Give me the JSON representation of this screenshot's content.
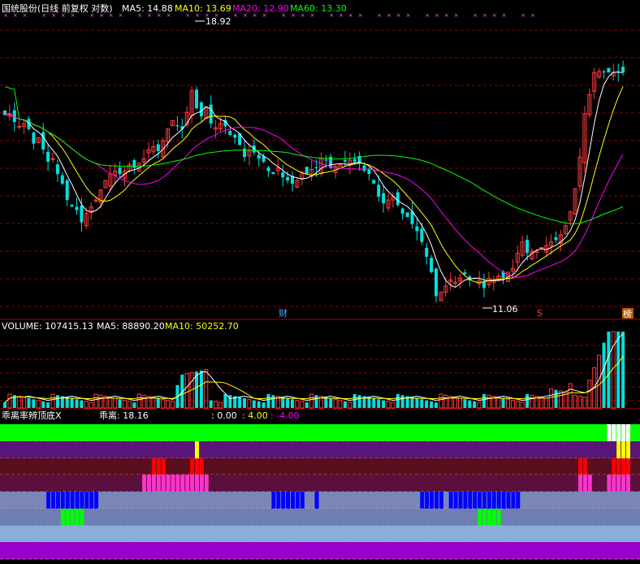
{
  "header": {
    "title": "国统股份(日线 前复权 对数)",
    "ma5": "MA5: 14.88",
    "ma10": "MA10: 13.69",
    "ma20": "MA20: 12.90",
    "ma60": "MA60: 13.30"
  },
  "annotations": {
    "high_label": "18.92",
    "low_label": "11.06",
    "marker_cai": "财",
    "marker_s": "S",
    "marker_bang": "榜"
  },
  "volume_header": {
    "volume": "VOLUME: 107415.13",
    "ma5": "MA5: 88890.20",
    "ma10": "MA10: 50252.70"
  },
  "indicator_header": {
    "name": "乖离率辨顶底X",
    "value_label": "乖离: 18.16",
    "v1": ": 0.00",
    "v2": ": 4.00",
    "v3": ": -4.00"
  },
  "colors": {
    "up": "#ff3b3b",
    "down": "#00e0e0",
    "ma5": "#ffffff",
    "ma10": "#ffff00",
    "ma20": "#ff00ff",
    "ma60": "#00ff00",
    "grid": "#8b0000"
  },
  "chart_data": {
    "type": "candlestick",
    "scale": "log",
    "y_range": [
      10.6,
      20.6
    ],
    "series_points": 130,
    "price_high": 18.92,
    "price_low": 11.06,
    "close_last": 18.16,
    "volume_last": 107415.13,
    "volume_ma5_last": 88890.2,
    "volume_ma10_last": 50252.7,
    "indicator_values": {
      "deviation": 18.16,
      "zero": 0.0,
      "upper": 4.0,
      "lower": -4.0
    },
    "closes": [
      16.55,
      16.6,
      16.3,
      16.15,
      16.25,
      16.05,
      15.55,
      15.75,
      15.35,
      14.95,
      15.05,
      14.55,
      14.25,
      13.75,
      13.55,
      13.45,
      13.1,
      13.35,
      13.55,
      13.75,
      14.05,
      14.35,
      14.55,
      14.65,
      14.55,
      14.65,
      14.85,
      14.75,
      14.9,
      15.05,
      15.35,
      15.45,
      15.3,
      15.65,
      16.05,
      16.35,
      16.15,
      16.05,
      16.65,
      17.45,
      16.8,
      16.5,
      16.85,
      16.25,
      16.1,
      16.25,
      16.15,
      15.85,
      15.75,
      15.5,
      15.1,
      15.3,
      15.25,
      15.05,
      14.95,
      14.65,
      14.55,
      14.75,
      14.45,
      14.35,
      14.25,
      14.35,
      14.6,
      14.55,
      14.7,
      14.75,
      15.05,
      15.0,
      14.75,
      14.8,
      14.85,
      14.95,
      15.0,
      14.95,
      14.9,
      14.65,
      14.55,
      14.25,
      13.85,
      13.65,
      13.75,
      13.85,
      13.6,
      13.35,
      13.25,
      13.05,
      12.85,
      12.55,
      12.15,
      11.75,
      11.15,
      11.25,
      11.4,
      11.55,
      11.5,
      11.6,
      11.7,
      11.55,
      11.6,
      11.55,
      11.35,
      11.6,
      11.55,
      11.65,
      11.6,
      11.75,
      11.85,
      12.25,
      12.55,
      12.25,
      12.3,
      12.3,
      12.4,
      12.45,
      12.55,
      12.6,
      12.75,
      13.0,
      13.4,
      14.1,
      15.1,
      16.6,
      17.3,
      18.16,
      18.2,
      18.16,
      18.16,
      18.16,
      18.16,
      18.16
    ],
    "volume_bars": 130,
    "indicator_rows": [
      {
        "name": "row1",
        "base": "#00ff00",
        "marks": "#ffffff"
      },
      {
        "name": "row2",
        "base": "#5a1578",
        "marks": "#ffff00"
      },
      {
        "name": "row3",
        "base": "#5a0f1e",
        "marks": "#ff0000"
      },
      {
        "name": "row4",
        "base": "#5a0f3c",
        "marks": "#ff33cc"
      },
      {
        "name": "row5",
        "base": "#7a86b8",
        "marks": "#0000ff"
      },
      {
        "name": "row6",
        "base": "#6e7eb4",
        "marks": "#00ff00"
      },
      {
        "name": "row7",
        "base": "#8aaed8",
        "marks": ""
      },
      {
        "name": "row8",
        "base": "#9900cc",
        "marks": ""
      }
    ]
  }
}
